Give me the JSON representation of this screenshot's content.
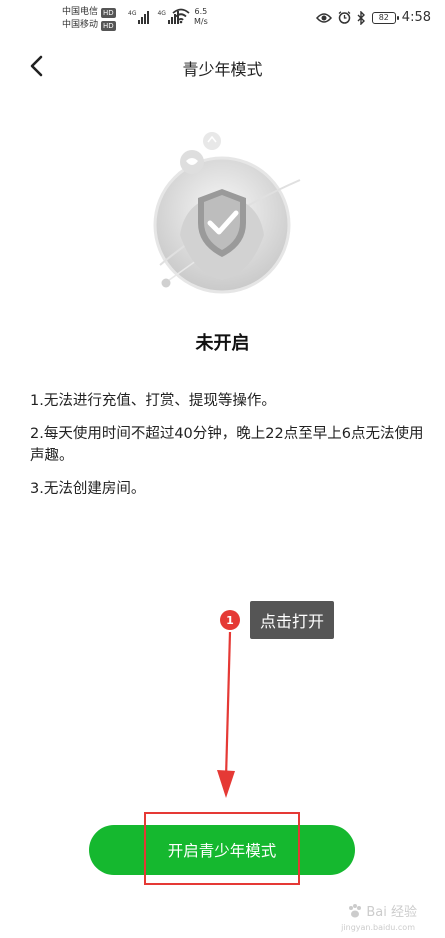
{
  "status_bar": {
    "carrier_1": "中国电信",
    "carrier_2": "中国移动",
    "hd_badge": "HD",
    "net_speed_value": "6.5",
    "net_speed_unit": "M/s",
    "battery": "82",
    "time": "4:58"
  },
  "nav": {
    "title": "青少年模式"
  },
  "main": {
    "status_text": "未开启",
    "rules": [
      "1.无法进行充值、打赏、提现等操作。",
      "2.每天使用时间不超过40分钟，晚上22点至早上6点无法使用声趣。",
      "3.无法创建房间。"
    ],
    "enable_button": "开启青少年模式"
  },
  "annotation": {
    "step_number": "1",
    "label": "点击打开"
  },
  "watermark": {
    "text": "Bai 经验",
    "sub": "jingyan.baidu.com"
  },
  "colors": {
    "button_green": "#15b82f",
    "annotation_red": "#e53935"
  }
}
